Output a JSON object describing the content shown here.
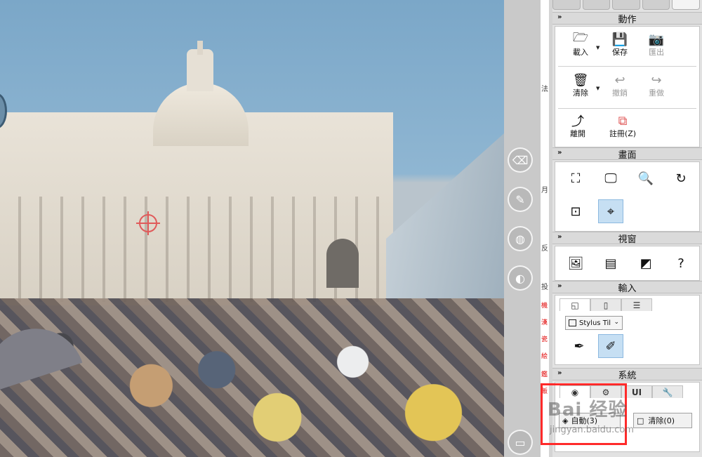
{
  "side_chars": [
    "法",
    "月",
    "反",
    "投"
  ],
  "side_red_chars": [
    "機",
    "漢",
    "瓷",
    "絵",
    "鑑",
    "飯"
  ],
  "panel": {
    "actions": {
      "title": "動作",
      "load": "載入",
      "save": "保存",
      "export": "匯出",
      "clear": "清除",
      "undo": "撤銷",
      "redo": "重做",
      "exit": "離開",
      "register": "註冊(Z)"
    },
    "screen": {
      "title": "畫面"
    },
    "window": {
      "title": "視窗",
      "help_glyph": "?"
    },
    "input": {
      "title": "輸入",
      "stylus_label": "Stylus Til"
    },
    "system": {
      "title": "系統",
      "tab_ui": "UI",
      "auto_label": "自動(3)",
      "clear_label": "清除(0)"
    }
  },
  "watermark": {
    "text": "Bai 经验",
    "url": "jingyan.baidu.com"
  },
  "icons": {
    "load": "folder-open-icon",
    "save": "floppy-disk-icon",
    "export": "camera-icon",
    "clear": "trash-icon",
    "undo": "undo-arrow-icon",
    "redo": "redo-arrow-icon",
    "exit": "exit-icon",
    "register": "register-icon",
    "fit_screen": "fit-screen-icon",
    "monitor": "monitor-icon",
    "zoom": "magnifier-icon",
    "rotate": "rotate-icon",
    "center": "center-dot-icon",
    "target": "target-crosshair-icon",
    "image": "image-view-icon",
    "info_panel": "info-panel-icon",
    "gradient": "gradient-icon",
    "help": "help-icon",
    "pen": "pen-tip-icon",
    "pen_tilt": "pen-tilt-icon"
  },
  "colors": {
    "highlight": "#ff2a2a",
    "selected": "#c6dff3",
    "crosshair": "#e05a5a"
  }
}
